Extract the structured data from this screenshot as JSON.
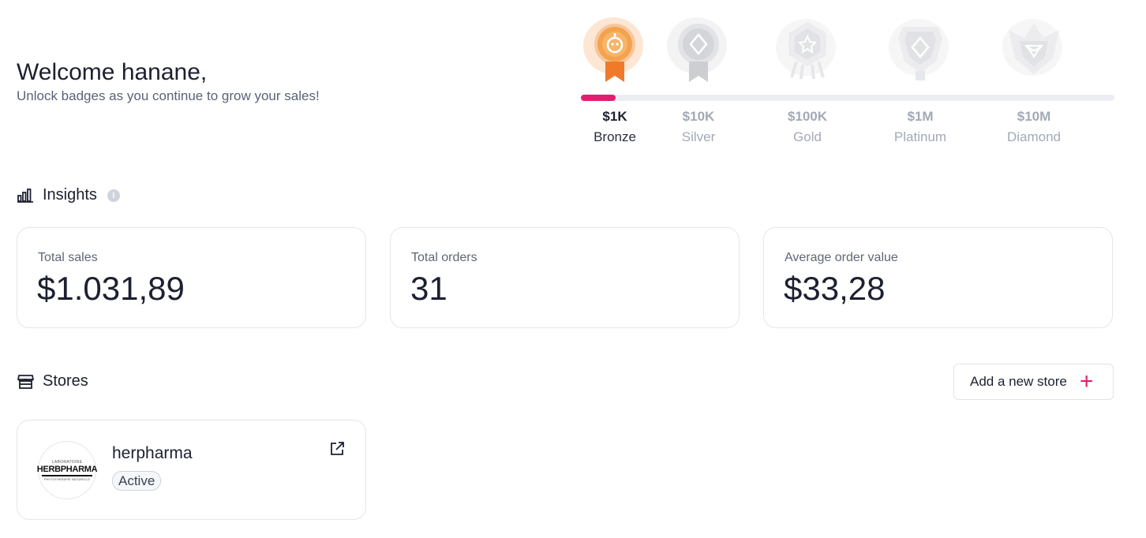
{
  "welcome": {
    "title": "Welcome hanane,",
    "subtitle": "Unlock badges as you continue to grow your sales!"
  },
  "badges": {
    "progress": 0.065,
    "accent_color": "#e0206e",
    "items": [
      {
        "amount": "$1K",
        "name": "Bronze",
        "icon": "bronze-medal-icon",
        "active": true
      },
      {
        "amount": "$10K",
        "name": "Silver",
        "icon": "silver-medal-icon",
        "active": false
      },
      {
        "amount": "$100K",
        "name": "Gold",
        "icon": "gold-medal-icon",
        "active": false
      },
      {
        "amount": "$1M",
        "name": "Platinum",
        "icon": "platinum-medal-icon",
        "active": false
      },
      {
        "amount": "$10M",
        "name": "Diamond",
        "icon": "diamond-medal-icon",
        "active": false
      }
    ]
  },
  "insights": {
    "title": "Insights",
    "info_icon": "i",
    "metrics": [
      {
        "label": "Total sales",
        "value": "$1.031,89"
      },
      {
        "label": "Total orders",
        "value": "31"
      },
      {
        "label": "Average order value",
        "value": "$33,28"
      }
    ]
  },
  "stores": {
    "title": "Stores",
    "add_label": "Add a new store",
    "add_icon": "+",
    "list": [
      {
        "name": "herpharma",
        "status": "Active",
        "logo": {
          "top": "LABORATOIRE",
          "main": "HERBPHARMA",
          "sub": "PHYTOTHERAPIE NATURELLE"
        }
      }
    ]
  }
}
